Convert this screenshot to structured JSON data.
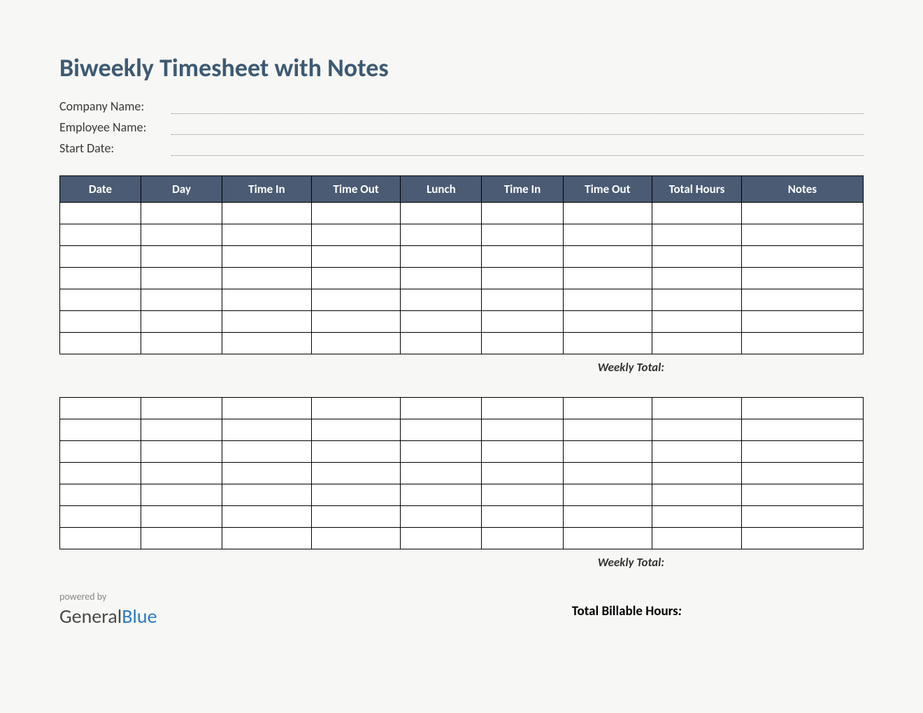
{
  "title": "Biweekly Timesheet with Notes",
  "info": {
    "companyLabel": "Company Name:",
    "employeeLabel": "Employee Name:",
    "startDateLabel": "Start Date:",
    "companyValue": "",
    "employeeValue": "",
    "startDateValue": ""
  },
  "headers": {
    "date": "Date",
    "day": "Day",
    "timeIn1": "Time In",
    "timeOut1": "Time Out",
    "lunch": "Lunch",
    "timeIn2": "Time In",
    "timeOut2": "Time Out",
    "totalHours": "Total Hours",
    "notes": "Notes"
  },
  "week1": {
    "rows": [
      {
        "date": "",
        "day": "",
        "timeIn1": "",
        "timeOut1": "",
        "lunch": "",
        "timeIn2": "",
        "timeOut2": "",
        "totalHours": "",
        "notes": ""
      },
      {
        "date": "",
        "day": "",
        "timeIn1": "",
        "timeOut1": "",
        "lunch": "",
        "timeIn2": "",
        "timeOut2": "",
        "totalHours": "",
        "notes": ""
      },
      {
        "date": "",
        "day": "",
        "timeIn1": "",
        "timeOut1": "",
        "lunch": "",
        "timeIn2": "",
        "timeOut2": "",
        "totalHours": "",
        "notes": ""
      },
      {
        "date": "",
        "day": "",
        "timeIn1": "",
        "timeOut1": "",
        "lunch": "",
        "timeIn2": "",
        "timeOut2": "",
        "totalHours": "",
        "notes": ""
      },
      {
        "date": "",
        "day": "",
        "timeIn1": "",
        "timeOut1": "",
        "lunch": "",
        "timeIn2": "",
        "timeOut2": "",
        "totalHours": "",
        "notes": ""
      },
      {
        "date": "",
        "day": "",
        "timeIn1": "",
        "timeOut1": "",
        "lunch": "",
        "timeIn2": "",
        "timeOut2": "",
        "totalHours": "",
        "notes": ""
      },
      {
        "date": "",
        "day": "",
        "timeIn1": "",
        "timeOut1": "",
        "lunch": "",
        "timeIn2": "",
        "timeOut2": "",
        "totalHours": "",
        "notes": ""
      }
    ],
    "weeklyTotalLabel": "Weekly Total:",
    "weeklyTotalValue": ""
  },
  "week2": {
    "rows": [
      {
        "date": "",
        "day": "",
        "timeIn1": "",
        "timeOut1": "",
        "lunch": "",
        "timeIn2": "",
        "timeOut2": "",
        "totalHours": "",
        "notes": ""
      },
      {
        "date": "",
        "day": "",
        "timeIn1": "",
        "timeOut1": "",
        "lunch": "",
        "timeIn2": "",
        "timeOut2": "",
        "totalHours": "",
        "notes": ""
      },
      {
        "date": "",
        "day": "",
        "timeIn1": "",
        "timeOut1": "",
        "lunch": "",
        "timeIn2": "",
        "timeOut2": "",
        "totalHours": "",
        "notes": ""
      },
      {
        "date": "",
        "day": "",
        "timeIn1": "",
        "timeOut1": "",
        "lunch": "",
        "timeIn2": "",
        "timeOut2": "",
        "totalHours": "",
        "notes": ""
      },
      {
        "date": "",
        "day": "",
        "timeIn1": "",
        "timeOut1": "",
        "lunch": "",
        "timeIn2": "",
        "timeOut2": "",
        "totalHours": "",
        "notes": ""
      },
      {
        "date": "",
        "day": "",
        "timeIn1": "",
        "timeOut1": "",
        "lunch": "",
        "timeIn2": "",
        "timeOut2": "",
        "totalHours": "",
        "notes": ""
      },
      {
        "date": "",
        "day": "",
        "timeIn1": "",
        "timeOut1": "",
        "lunch": "",
        "timeIn2": "",
        "timeOut2": "",
        "totalHours": "",
        "notes": ""
      }
    ],
    "weeklyTotalLabel": "Weekly Total:",
    "weeklyTotalValue": ""
  },
  "footer": {
    "poweredBy": "powered by",
    "brandGeneral": "General",
    "brandBlue": "Blue",
    "totalBillableLabel": "Total Billable Hours",
    "totalBillableColon": ":",
    "totalBillableValue": ""
  }
}
